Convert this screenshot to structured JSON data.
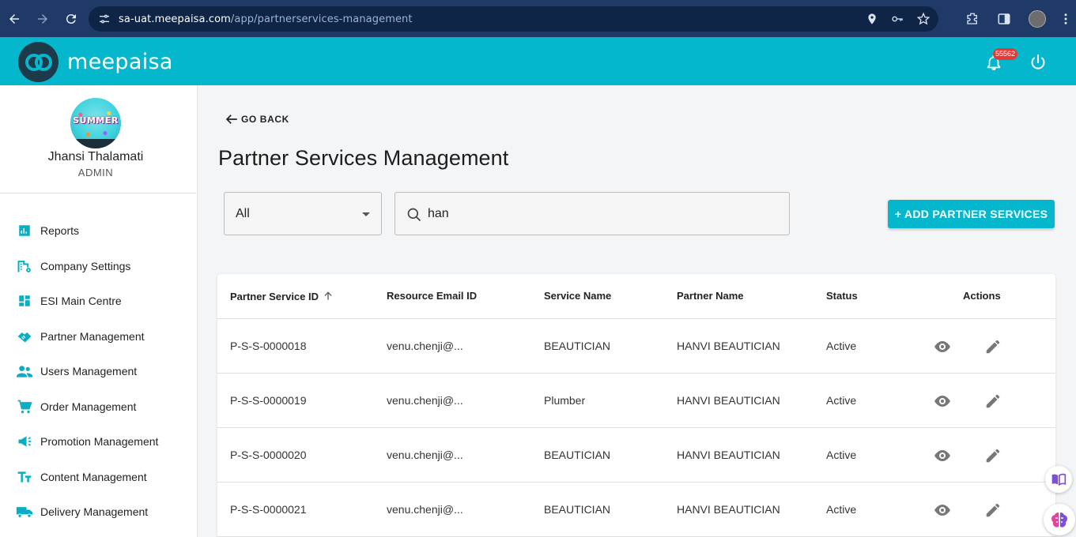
{
  "browser": {
    "url_host": "sa-uat.meepaisa.com",
    "url_path": "/app/partnerservices-management"
  },
  "header": {
    "logo_text": "meepaisa",
    "notification_count": "55562"
  },
  "sidebar": {
    "user_name": "Jhansi Thalamati",
    "user_role": "ADMIN",
    "avatar_text": "SUMMER",
    "items": [
      {
        "label": "Reports",
        "icon": "bar-chart-icon"
      },
      {
        "label": "Company Settings",
        "icon": "building-settings-icon"
      },
      {
        "label": "ESI Main Centre",
        "icon": "dashboard-icon"
      },
      {
        "label": "Partner Management",
        "icon": "handshake-icon"
      },
      {
        "label": "Users Management",
        "icon": "people-icon"
      },
      {
        "label": "Order Management",
        "icon": "cart-icon"
      },
      {
        "label": "Promotion Management",
        "icon": "campaign-icon"
      },
      {
        "label": "Content Management",
        "icon": "text-fields-icon"
      },
      {
        "label": "Delivery Management",
        "icon": "truck-icon"
      }
    ]
  },
  "main": {
    "go_back": "GO BACK",
    "title": "Partner Services Management",
    "filter_value": "All",
    "search_value": "han",
    "add_button": "+ ADD PARTNER SERVICES",
    "columns": [
      "Partner Service ID",
      "Resource Email ID",
      "Service Name",
      "Partner Name",
      "Status",
      "Actions"
    ],
    "rows": [
      {
        "id": "P-S-S-0000018",
        "email": "venu.chenji@...",
        "service": "BEAUTICIAN",
        "partner": "HANVI BEAUTICIAN",
        "status": "Active"
      },
      {
        "id": "P-S-S-0000019",
        "email": "venu.chenji@...",
        "service": "Plumber",
        "partner": "HANVI BEAUTICIAN",
        "status": "Active"
      },
      {
        "id": "P-S-S-0000020",
        "email": "venu.chenji@...",
        "service": "BEAUTICIAN",
        "partner": "HANVI BEAUTICIAN",
        "status": "Active"
      },
      {
        "id": "P-S-S-0000021",
        "email": "venu.chenji@...",
        "service": "BEAUTICIAN",
        "partner": "HANVI BEAUTICIAN",
        "status": "Active"
      }
    ]
  },
  "colors": {
    "accent": "#05b7cd",
    "browser_chrome": "#1f3a66",
    "badge": "#e53935"
  }
}
